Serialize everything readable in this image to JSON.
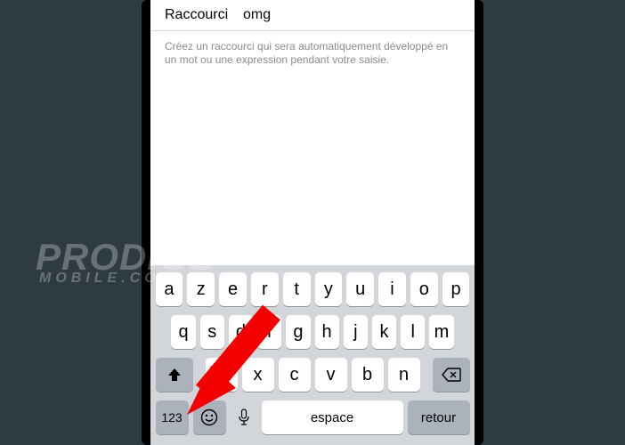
{
  "form": {
    "shortcut_label": "Raccourci",
    "shortcut_value": "omg",
    "help_text": "Créez un raccourci qui sera automatiquement développé en un mot ou une expression pendant votre saisie."
  },
  "keyboard": {
    "row1": [
      "a",
      "z",
      "e",
      "r",
      "t",
      "y",
      "u",
      "i",
      "o",
      "p"
    ],
    "row2": [
      "q",
      "s",
      "d",
      "f",
      "g",
      "h",
      "j",
      "k",
      "l",
      "m"
    ],
    "row3": [
      "w",
      "x",
      "c",
      "v",
      "b",
      "n"
    ],
    "nums_label": "123",
    "space_label": "espace",
    "return_label": "retour"
  },
  "watermark": {
    "line1": "PRODIGE",
    "line2": "MOBILE.COM"
  }
}
